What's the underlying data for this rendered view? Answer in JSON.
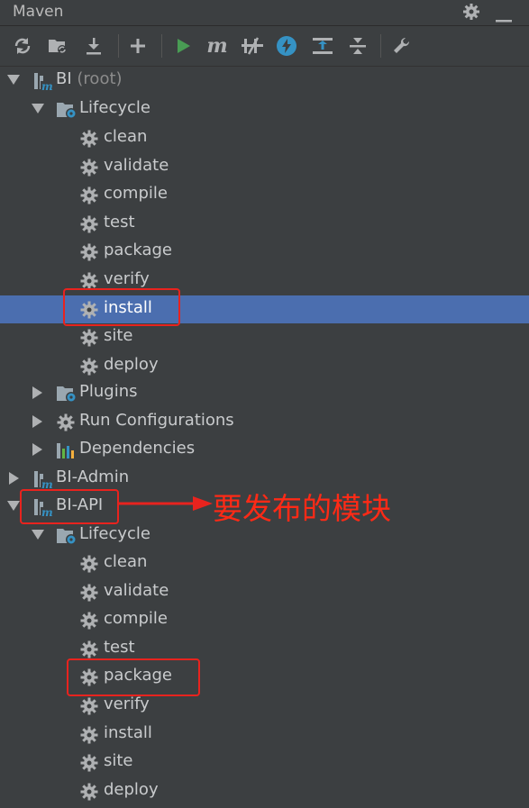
{
  "panel": {
    "title": "Maven"
  },
  "toolbar": {
    "buttons": [
      {
        "name": "reload-icon"
      },
      {
        "name": "generate-sources-icon"
      },
      {
        "name": "download-icon"
      },
      {
        "name": "add-icon"
      },
      {
        "name": "run-icon"
      },
      {
        "name": "execute-goal-icon"
      },
      {
        "name": "toggle-offline-icon"
      },
      {
        "name": "skip-tests-icon"
      },
      {
        "name": "show-dependencies-icon"
      },
      {
        "name": "collapse-all-icon"
      },
      {
        "name": "settings-wrench-icon"
      }
    ]
  },
  "tree": {
    "root": {
      "name": "BI",
      "suffix": "(root)"
    },
    "lifecycle_label": "Lifecycle",
    "lifecycle_goals": [
      "clean",
      "validate",
      "compile",
      "test",
      "package",
      "verify",
      "install",
      "site",
      "deploy"
    ],
    "plugins_label": "Plugins",
    "run_config_label": "Run Configurations",
    "dependencies_label": "Dependencies",
    "modules": [
      "BI-Admin",
      "BI-API"
    ],
    "selected_goal": "install"
  },
  "annotation": {
    "text": "要发布的模块",
    "color": "#ff2a16"
  },
  "colors": {
    "background": "#3c3f41",
    "selection": "#4b6eaf",
    "highlight_box": "#e8231e"
  }
}
